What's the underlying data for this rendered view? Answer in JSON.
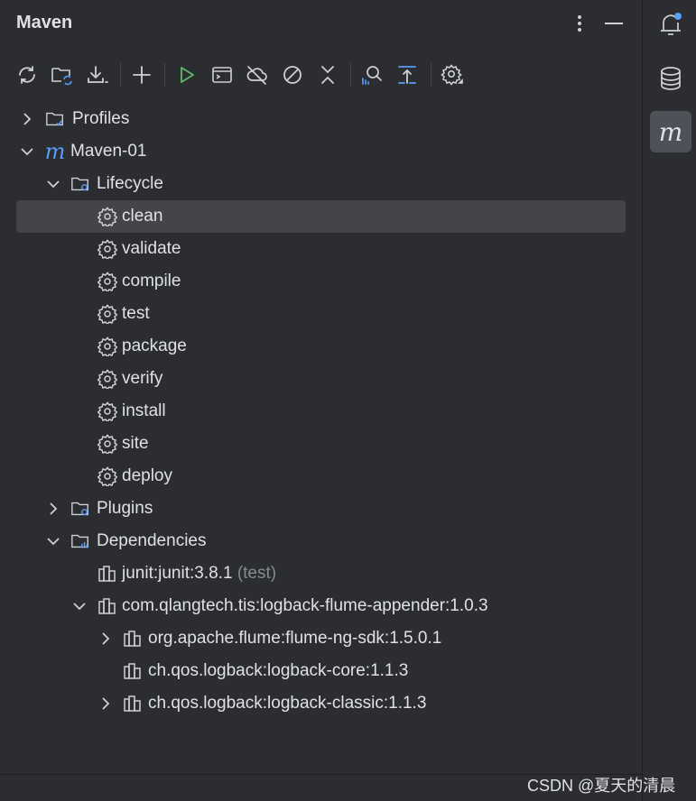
{
  "header": {
    "title": "Maven"
  },
  "tree": {
    "profiles": "Profiles",
    "project": "Maven-01",
    "lifecycle": "Lifecycle",
    "goals": [
      "clean",
      "validate",
      "compile",
      "test",
      "package",
      "verify",
      "install",
      "site",
      "deploy"
    ],
    "plugins": "Plugins",
    "dependencies": "Dependencies",
    "deps": {
      "junit": "junit:junit:3.8.1",
      "junit_scope": "(test)",
      "appender": "com.qlangtech.tis:logback-flume-appender:1.0.3",
      "flume": "org.apache.flume:flume-ng-sdk:1.5.0.1",
      "core": "ch.qos.logback:logback-core:1.1.3",
      "classic": "ch.qos.logback:logback-classic:1.1.3"
    }
  },
  "watermark": "CSDN @夏天的清晨",
  "colors": {
    "accent": "#589df6",
    "selected": "#43454a",
    "run": "#5fb865",
    "background": "#2b2d30"
  }
}
